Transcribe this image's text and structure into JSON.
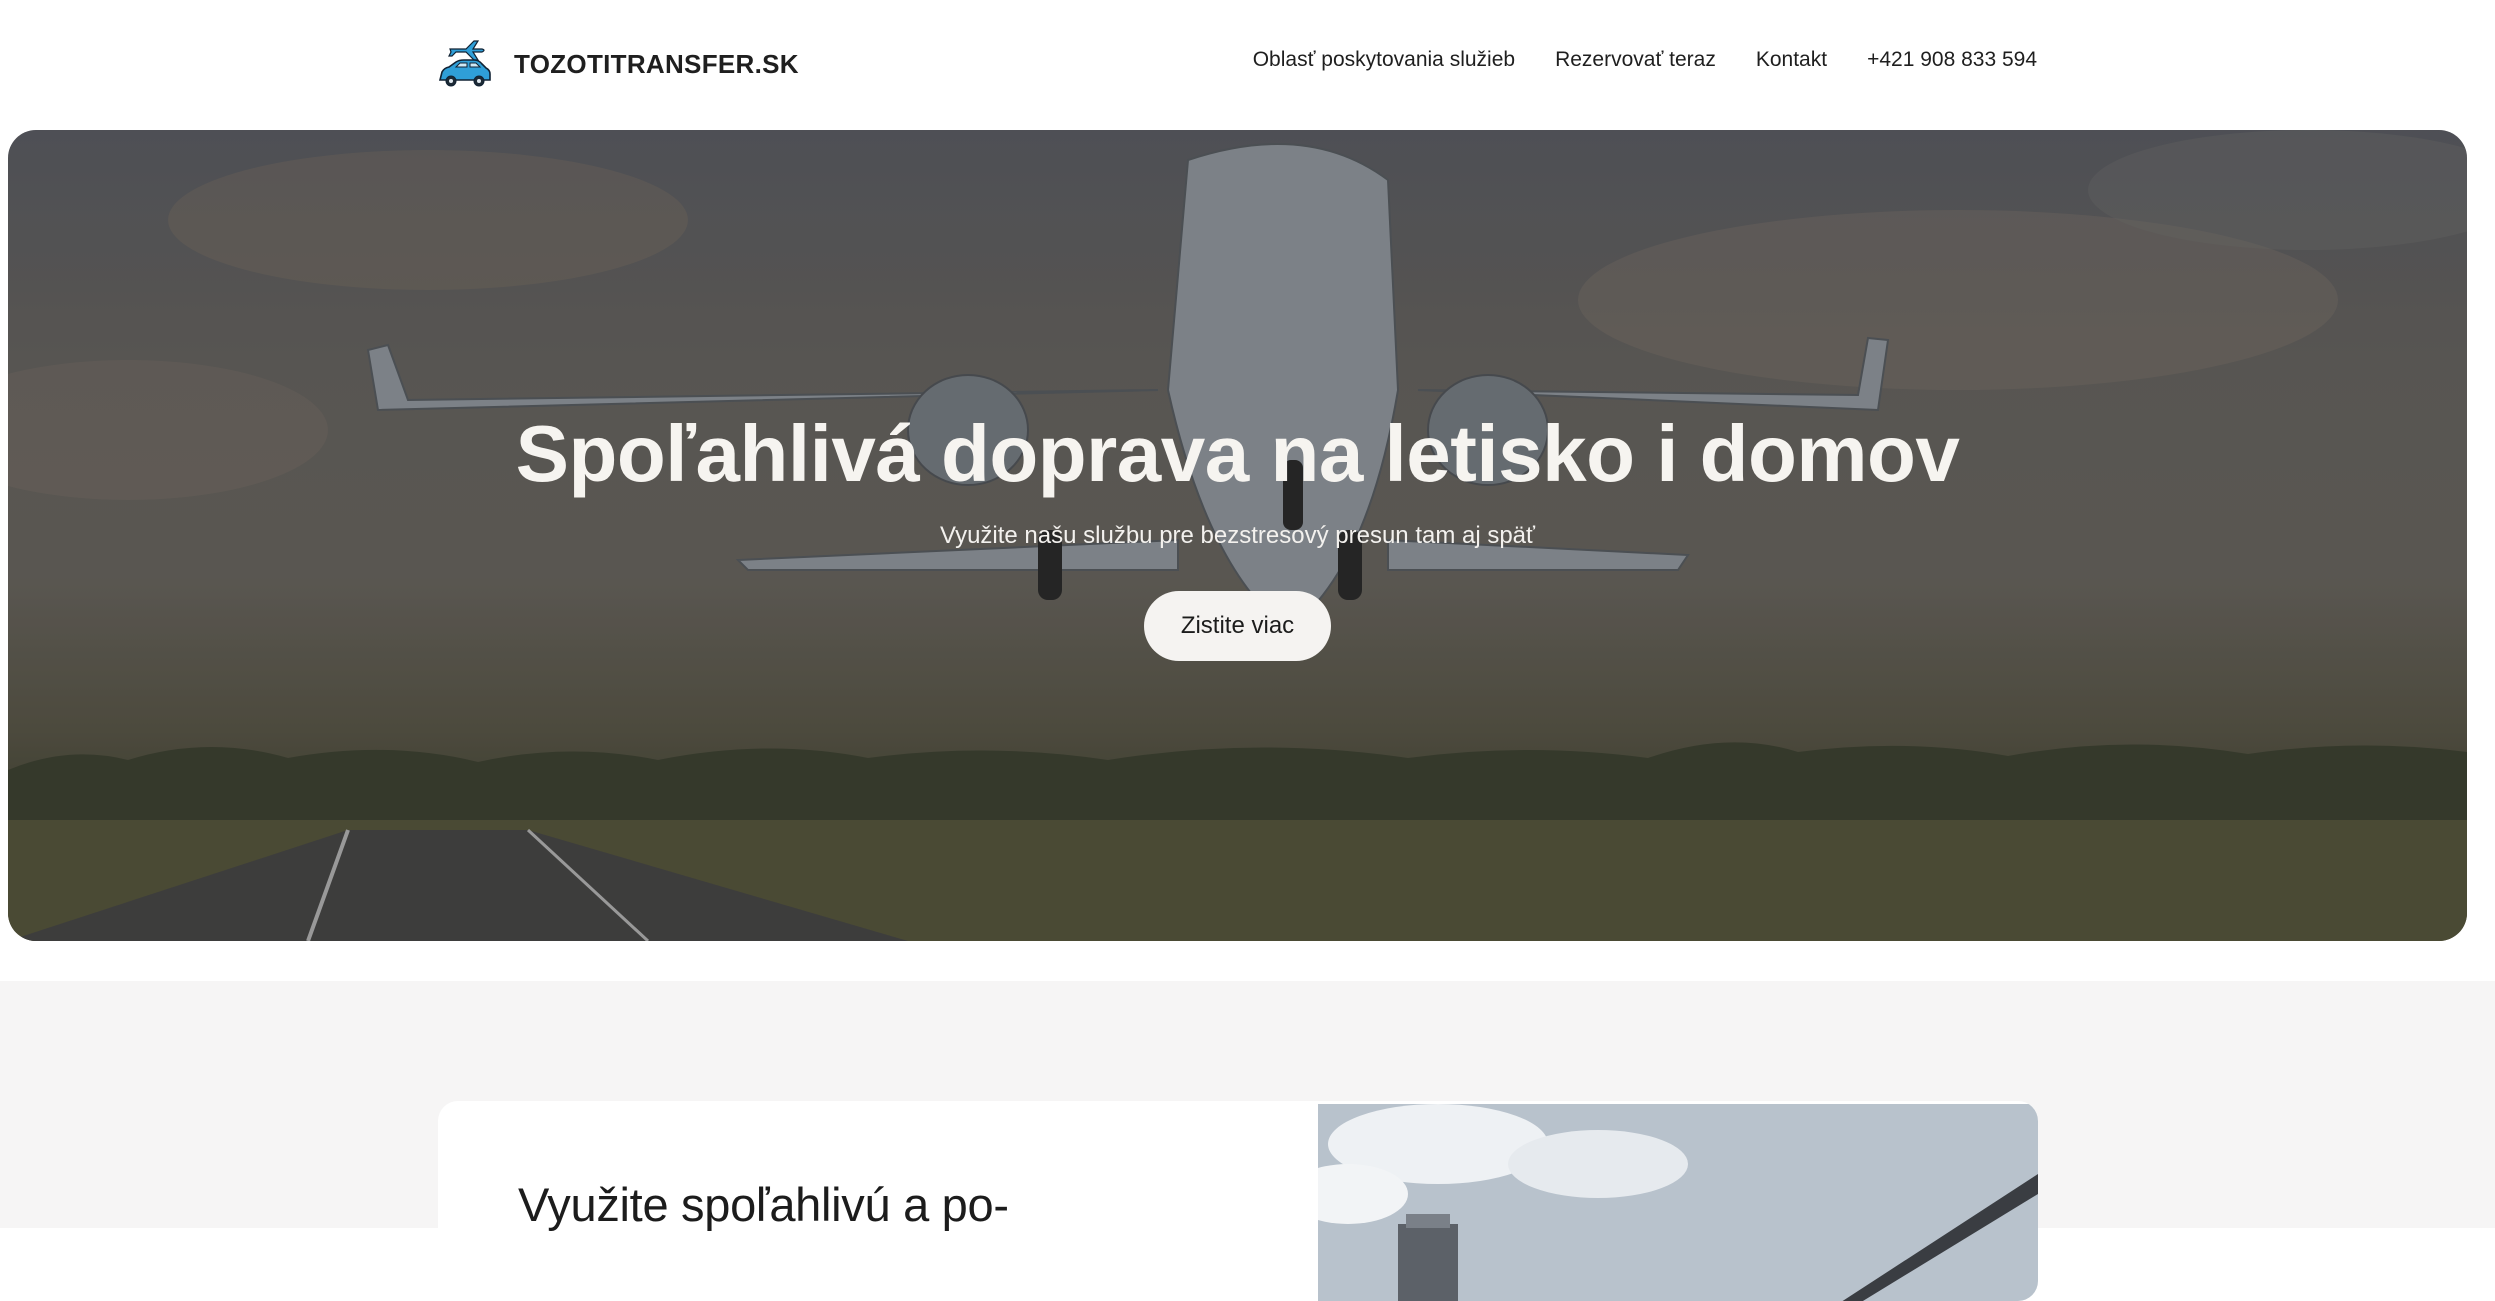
{
  "header": {
    "brand": "TOZOTITRANSFER.SK",
    "logo_icon": "plane-and-car-icon",
    "nav": [
      {
        "label": "Oblasť poskytovania služieb"
      },
      {
        "label": "Rezervovať teraz"
      },
      {
        "label": "Kontakt"
      },
      {
        "label": "+421 908 833 594"
      }
    ]
  },
  "hero": {
    "title": "Spoľahlivá doprava na letisko i domov",
    "subtitle": "Využite našu službu pre bezstresový presun tam aj späť",
    "cta_label": "Zistite viac",
    "background": "airplane-takeoff-photo"
  },
  "intro": {
    "title": "Využite spoľahlivú a po-",
    "image": "airport-terminal-photo"
  },
  "colors": {
    "header_bg": "#ffffff",
    "hero_button_bg": "#f5f3f1",
    "section_bg": "#f6f5f5",
    "logo_blue": "#2f9fd8",
    "text_dark": "#1c1c1c"
  }
}
